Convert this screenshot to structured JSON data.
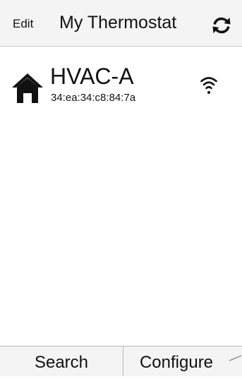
{
  "header": {
    "edit_label": "Edit",
    "title": "My Thermostat",
    "refresh_icon": "refresh-icon"
  },
  "devices": [
    {
      "icon": "home-icon",
      "name": "HVAC-A",
      "mac": "34:ea:34:c8:84:7a",
      "status_icon": "wifi-icon"
    }
  ],
  "toolbar": {
    "search_label": "Search",
    "configure_label": "Configure"
  },
  "colors": {
    "bar_background": "#f4f4f4",
    "divider": "#b9b9b9",
    "text": "#111111"
  }
}
